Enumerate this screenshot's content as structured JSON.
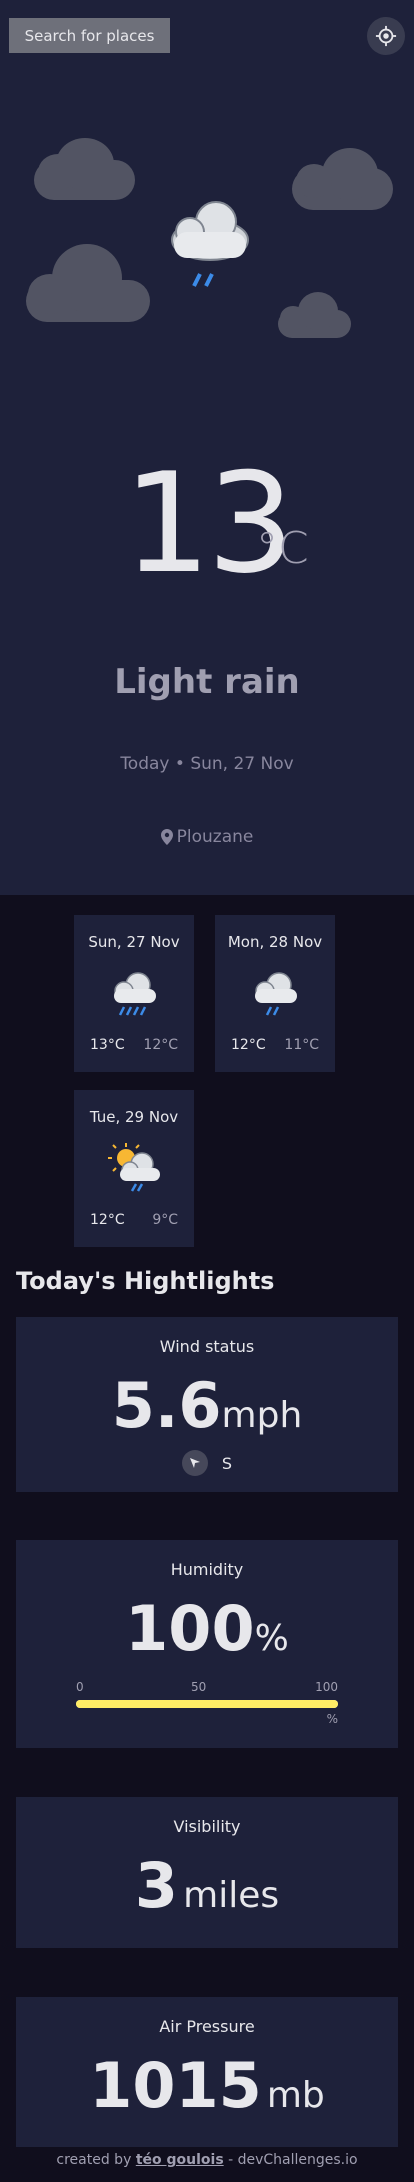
{
  "search": {
    "label": "Search for places"
  },
  "icons": {
    "locate": "gps-target-icon",
    "weather_main": "light-rain-icon",
    "location_pin": "map-pin-icon",
    "wind_arrow": "navigation-arrow-icon"
  },
  "current": {
    "temperature": "13",
    "unit": "°C",
    "condition": "Light rain",
    "date": "Today • Sun, 27 Nov",
    "location": "Plouzane"
  },
  "forecast": [
    {
      "date": "Sun, 27 Nov",
      "max": "13°C",
      "min": "12°C",
      "icon": "heavy-rain-icon"
    },
    {
      "date": "Mon, 28 Nov",
      "max": "12°C",
      "min": "11°C",
      "icon": "light-rain-icon"
    },
    {
      "date": "Tue, 29 Nov",
      "max": "12°C",
      "min": "9°C",
      "icon": "sun-cloud-rain-icon"
    }
  ],
  "highlights": {
    "title": "Today's Hightlights",
    "wind": {
      "label": "Wind status",
      "value": "5.6",
      "unit": "mph",
      "direction": "S"
    },
    "humidity": {
      "label": "Humidity",
      "value": "100",
      "unit": "%",
      "scale": [
        "0",
        "50",
        "100"
      ],
      "scale_unit": "%",
      "level": 1.0
    },
    "visibility": {
      "label": "Visibility",
      "value": "3",
      "unit": "miles"
    },
    "pressure": {
      "label": "Air Pressure",
      "value": "1015",
      "unit": "mb"
    }
  },
  "footer": {
    "prefix": "created by ",
    "author": "téo goulois",
    "suffix": " - devChallenges.io"
  },
  "colors": {
    "accent": "#ffec65",
    "panel": "#1e213a",
    "background": "#100e1d",
    "rain": "#3c8be8"
  }
}
